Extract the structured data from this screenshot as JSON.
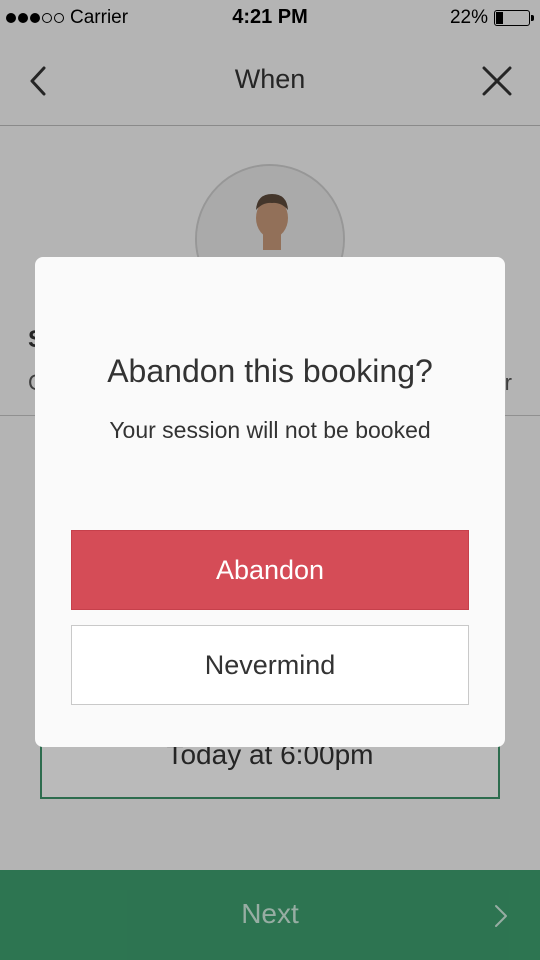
{
  "status_bar": {
    "carrier": "Carrier",
    "time": "4:21 PM",
    "battery": "22%",
    "battery_level": 0.22,
    "signal_dots_filled": 3,
    "signal_dots_total": 5
  },
  "nav": {
    "title": "When",
    "back_icon": "chevron-left-icon",
    "close_icon": "close-icon"
  },
  "content": {
    "partial_left_a": "S",
    "partial_left_b": "C",
    "partial_right": "r",
    "time_box_label": "Today at 6:00pm",
    "next_label": "Next",
    "next_icon": "chevron-right-icon"
  },
  "modal": {
    "title": "Abandon this booking?",
    "subtitle": "Your session will not be booked",
    "abandon_label": "Abandon",
    "nevermind_label": "Nevermind"
  },
  "colors": {
    "accent_green": "#3ea06f",
    "abandon_red": "#d54c57",
    "overlay": "rgba(0,0,0,0.27)"
  }
}
